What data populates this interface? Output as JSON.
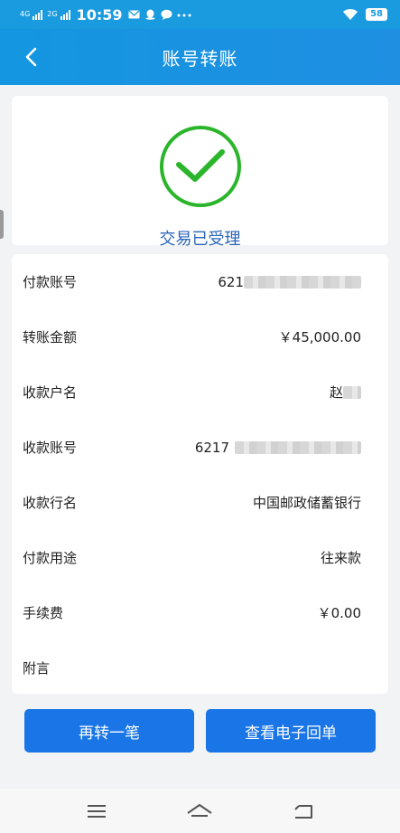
{
  "status_bar": {
    "signal1_label": "4G",
    "signal2_label": "2G",
    "time": "10:59",
    "battery": "58"
  },
  "header": {
    "title": "账号转账"
  },
  "result": {
    "status_text": "交易已受理"
  },
  "details": [
    {
      "label": "付款账号",
      "value": "621",
      "masked": true
    },
    {
      "label": "转账金额",
      "value": "￥45,000.00",
      "masked": false
    },
    {
      "label": "收款户名",
      "value": "赵",
      "masked": true
    },
    {
      "label": "收款账号",
      "value": "6217",
      "masked": true
    },
    {
      "label": "收款行名",
      "value": "中国邮政储蓄银行",
      "masked": false
    },
    {
      "label": "付款用途",
      "value": "往来款",
      "masked": false
    },
    {
      "label": "手续费",
      "value": "￥0.00",
      "masked": false
    },
    {
      "label": "附言",
      "value": "",
      "masked": false
    }
  ],
  "actions": {
    "again_label": "再转一笔",
    "receipt_label": "查看电子回单"
  },
  "colors": {
    "primary": "#1a75e6",
    "header": "#1a9be0",
    "success_green": "#2bb52b",
    "status_text": "#2a64b8"
  }
}
